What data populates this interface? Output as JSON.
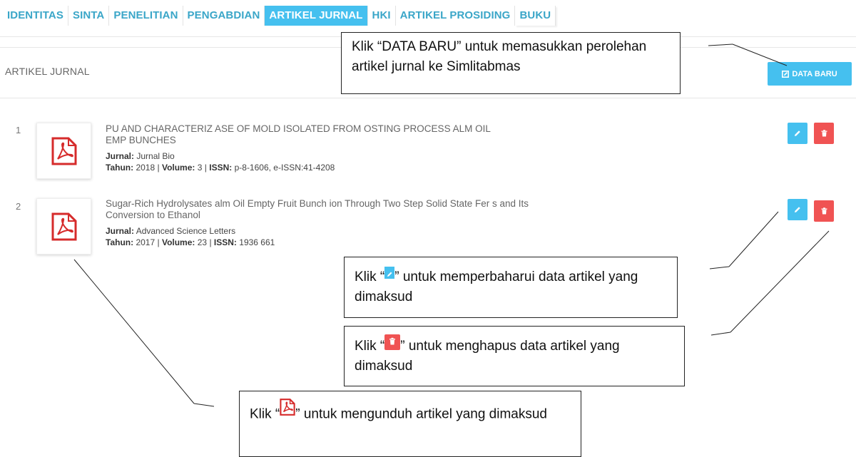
{
  "tabs": [
    "IDENTITAS",
    "SINTA",
    "PENELITIAN",
    "PENGABDIAN",
    "ARTIKEL JURNAL",
    "HKI",
    "ARTIKEL PROSIDING",
    "BUKU"
  ],
  "active_tab": "ARTIKEL JURNAL",
  "section_title": "ARTIKEL JURNAL",
  "new_button_label": "DATA BARU",
  "articles": [
    {
      "num": "1",
      "title_line1": "PU AND CHARACTERIZ ASE OF MOLD ISOLATED FROM OSTING PROCESS ALM OIL",
      "title_line2": "EMP BUNCHES",
      "journal_label": "Jurnal:",
      "journal": "Jurnal Bio",
      "year_label": "Tahun:",
      "year": "2018",
      "volume_label": "Volume:",
      "volume": "3",
      "issn_label": "ISSN:",
      "issn": "p-8-1606, e-ISSN:41-4208"
    },
    {
      "num": "2",
      "title_line1": "Sugar-Rich Hydrolysates alm Oil Empty Fruit Bunch ion Through Two Step Solid State Fer s and Its",
      "title_line2": "Conversion to Ethanol",
      "journal_label": "Jurnal:",
      "journal": "Advanced Science Letters",
      "year_label": "Tahun:",
      "year": "2017",
      "volume_label": "Volume:",
      "volume": "23",
      "issn_label": "ISSN:",
      "issn": "1936 661"
    }
  ],
  "callouts": {
    "new": "Klik “DATA BARU” untuk memasukkan perolehan artikel jurnal ke Simlitabmas",
    "edit_pre": "Klik “",
    "edit_post": "” untuk memperbaharui data artikel yang dimaksud",
    "delete_pre": "Klik “",
    "delete_post": "” untuk menghapus data artikel yang dimaksud",
    "pdf_pre": "Klik “",
    "pdf_post": "” untuk mengunduh artikel yang dimaksud"
  },
  "colors": {
    "accent": "#45c0ef",
    "danger": "#f05353",
    "pdf": "#d62b2b"
  },
  "icons": [
    "pdf-icon",
    "pencil-icon",
    "trash-icon",
    "edit-square-icon"
  ]
}
